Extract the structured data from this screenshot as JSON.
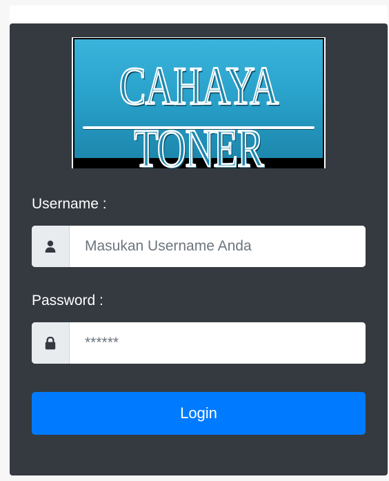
{
  "logo": {
    "text": "CAHAYA TONER"
  },
  "form": {
    "username": {
      "label": "Username :",
      "placeholder": "Masukan Username Anda",
      "icon": "user-icon"
    },
    "password": {
      "label": "Password :",
      "placeholder": "******",
      "icon": "lock-icon"
    },
    "login_label": "Login"
  },
  "colors": {
    "card_background": "#343a40",
    "button_primary": "#007bff",
    "logo_blue": "#2aa3cc",
    "addon_background": "#e9ecef"
  }
}
